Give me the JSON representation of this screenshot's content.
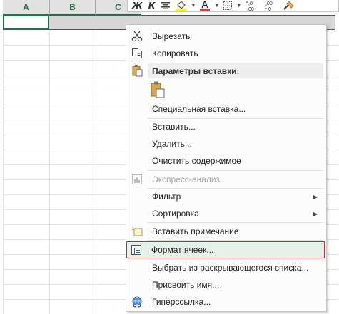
{
  "sheet": {
    "columns": [
      "A",
      "B",
      "C"
    ]
  },
  "minibar": {
    "bold_label": "Ж",
    "italic_label": "К",
    "decimal_increase": ",0\n,00",
    "decimal_decrease": ",00\n,0"
  },
  "menu": {
    "cut": "Вырезать",
    "copy": "Копировать",
    "paste_options": "Параметры вставки:",
    "paste_special": "Специальная вставка...",
    "insert": "Вставить...",
    "delete": "Удалить...",
    "clear": "Очистить содержимое",
    "quick_analysis": "Экспресс-анализ",
    "filter": "Фильтр",
    "sort": "Сортировка",
    "insert_comment": "Вставить примечание",
    "format_cells": "Формат ячеек...",
    "pick_from_list": "Выбрать из раскрывающегося списка...",
    "define_name": "Присвоить имя...",
    "hyperlink": "Гиперссылка..."
  },
  "colors": {
    "accent": "#217346",
    "highlight_border": "#cc2b2b",
    "highlight_fill": "#e6f2e9"
  }
}
